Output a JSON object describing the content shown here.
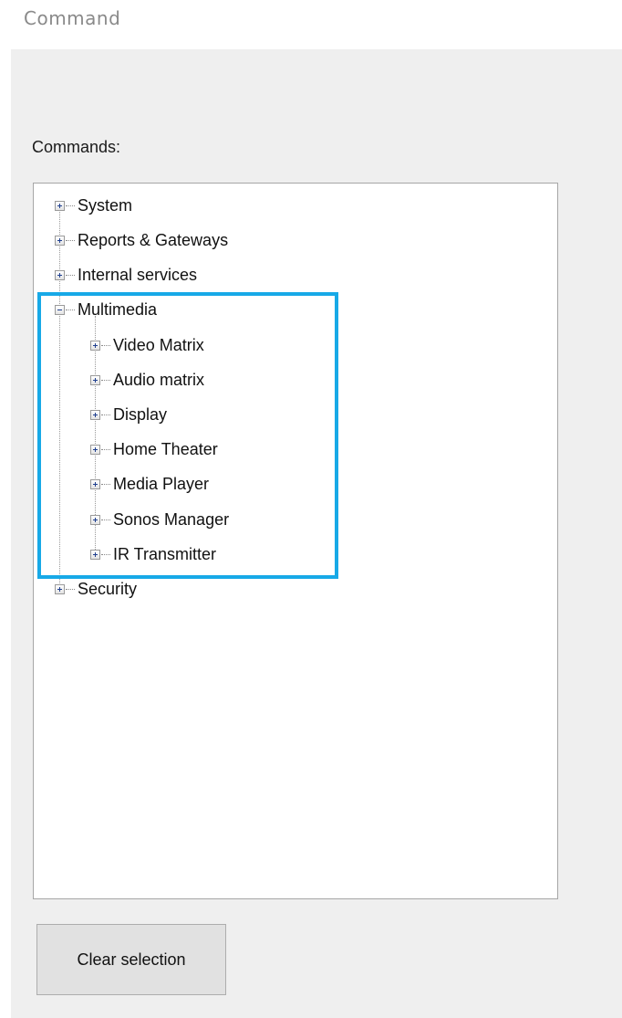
{
  "window": {
    "title": "Command"
  },
  "commands": {
    "label": "Commands:",
    "tree": {
      "root_items": [
        {
          "label": "System",
          "expanded": false
        },
        {
          "label": "Reports & Gateways",
          "expanded": false
        },
        {
          "label": "Internal services",
          "expanded": false
        },
        {
          "label": "Multimedia",
          "expanded": true,
          "children": [
            {
              "label": "Video Matrix",
              "expanded": false
            },
            {
              "label": "Audio matrix",
              "expanded": false
            },
            {
              "label": "Display",
              "expanded": false
            },
            {
              "label": "Home Theater",
              "expanded": false
            },
            {
              "label": "Media Player",
              "expanded": false
            },
            {
              "label": "Sonos Manager",
              "expanded": false
            },
            {
              "label": "IR Transmitter",
              "expanded": false
            }
          ]
        },
        {
          "label": "Security",
          "expanded": false
        }
      ]
    }
  },
  "actions": {
    "clear_selection_label": "Clear  selection"
  },
  "colors": {
    "highlight": "#17a9e7",
    "panel_background": "#efefef",
    "tree_background": "#ffffff"
  }
}
